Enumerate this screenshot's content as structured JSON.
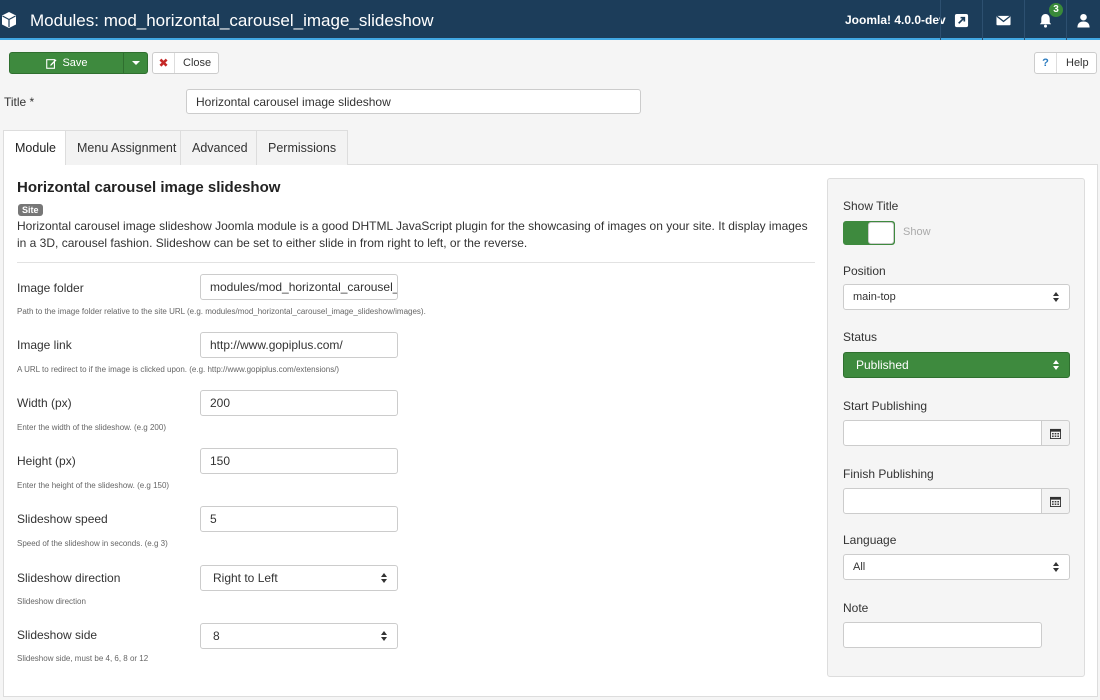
{
  "header": {
    "title": "Modules: mod_horizontal_carousel_image_slideshow",
    "version": "Joomla! 4.0.0-dev",
    "notification_count": "3",
    "colors": {
      "bar": "#1c3d5a",
      "accent_line": "#41a8e3",
      "badge": "#3a8a3a"
    },
    "icons": [
      "cube-icon",
      "external-link-icon",
      "envelope-icon",
      "bell-icon",
      "user-icon"
    ]
  },
  "toolbar": {
    "save_label": "Save",
    "close_label": "Close",
    "help_label": "Help",
    "close_glyph": "✖",
    "help_glyph": "?"
  },
  "title_field": {
    "label": "Title *",
    "value": "Horizontal carousel image slideshow"
  },
  "tabs": [
    {
      "label": "Module",
      "active": true
    },
    {
      "label": "Menu Assignment",
      "active": false
    },
    {
      "label": "Advanced",
      "active": false
    },
    {
      "label": "Permissions",
      "active": false
    }
  ],
  "module": {
    "heading": "Horizontal carousel image slideshow",
    "badge": "Site",
    "description": "Horizontal carousel image slideshow Joomla module is a good DHTML JavaScript plugin for the showcasing of images on your site. It display images in a 3D, carousel fashion. Slideshow can be set to either slide in from right to left, or the reverse."
  },
  "fields": [
    {
      "label": "Image folder",
      "value": "modules/mod_horizontal_carousel_image_slideshow/images/",
      "help": "Path to the image folder relative to the site URL (e.g. modules/mod_horizontal_carousel_image_slideshow/images).",
      "type": "text"
    },
    {
      "label": "Image link",
      "value": "http://www.gopiplus.com/",
      "help": "A URL to redirect to if the image is clicked upon. (e.g. http://www.gopiplus.com/extensions/)",
      "type": "text"
    },
    {
      "label": "Width (px)",
      "value": "200",
      "help": "Enter the width of the slideshow. (e.g 200)",
      "type": "text"
    },
    {
      "label": "Height (px)",
      "value": "150",
      "help": "Enter the height of the slideshow. (e.g 150)",
      "type": "text"
    },
    {
      "label": "Slideshow speed",
      "value": "5",
      "help": "Speed of the slideshow in seconds. (e.g 3)",
      "type": "text"
    },
    {
      "label": "Slideshow direction",
      "value": "Right to Left",
      "help": "Slideshow direction",
      "type": "select"
    },
    {
      "label": "Slideshow side",
      "value": "8",
      "help": "Slideshow side, must be 4, 6, 8 or 12",
      "type": "select"
    }
  ],
  "sidebar": {
    "show_title": {
      "label": "Show Title",
      "state": "Show"
    },
    "position": {
      "label": "Position",
      "value": "main-top"
    },
    "status": {
      "label": "Status",
      "value": "Published"
    },
    "start_publishing": {
      "label": "Start Publishing",
      "value": ""
    },
    "finish_publishing": {
      "label": "Finish Publishing",
      "value": ""
    },
    "language": {
      "label": "Language",
      "value": "All"
    },
    "note": {
      "label": "Note",
      "value": ""
    },
    "colors": {
      "published": "#3e8a3e"
    }
  }
}
